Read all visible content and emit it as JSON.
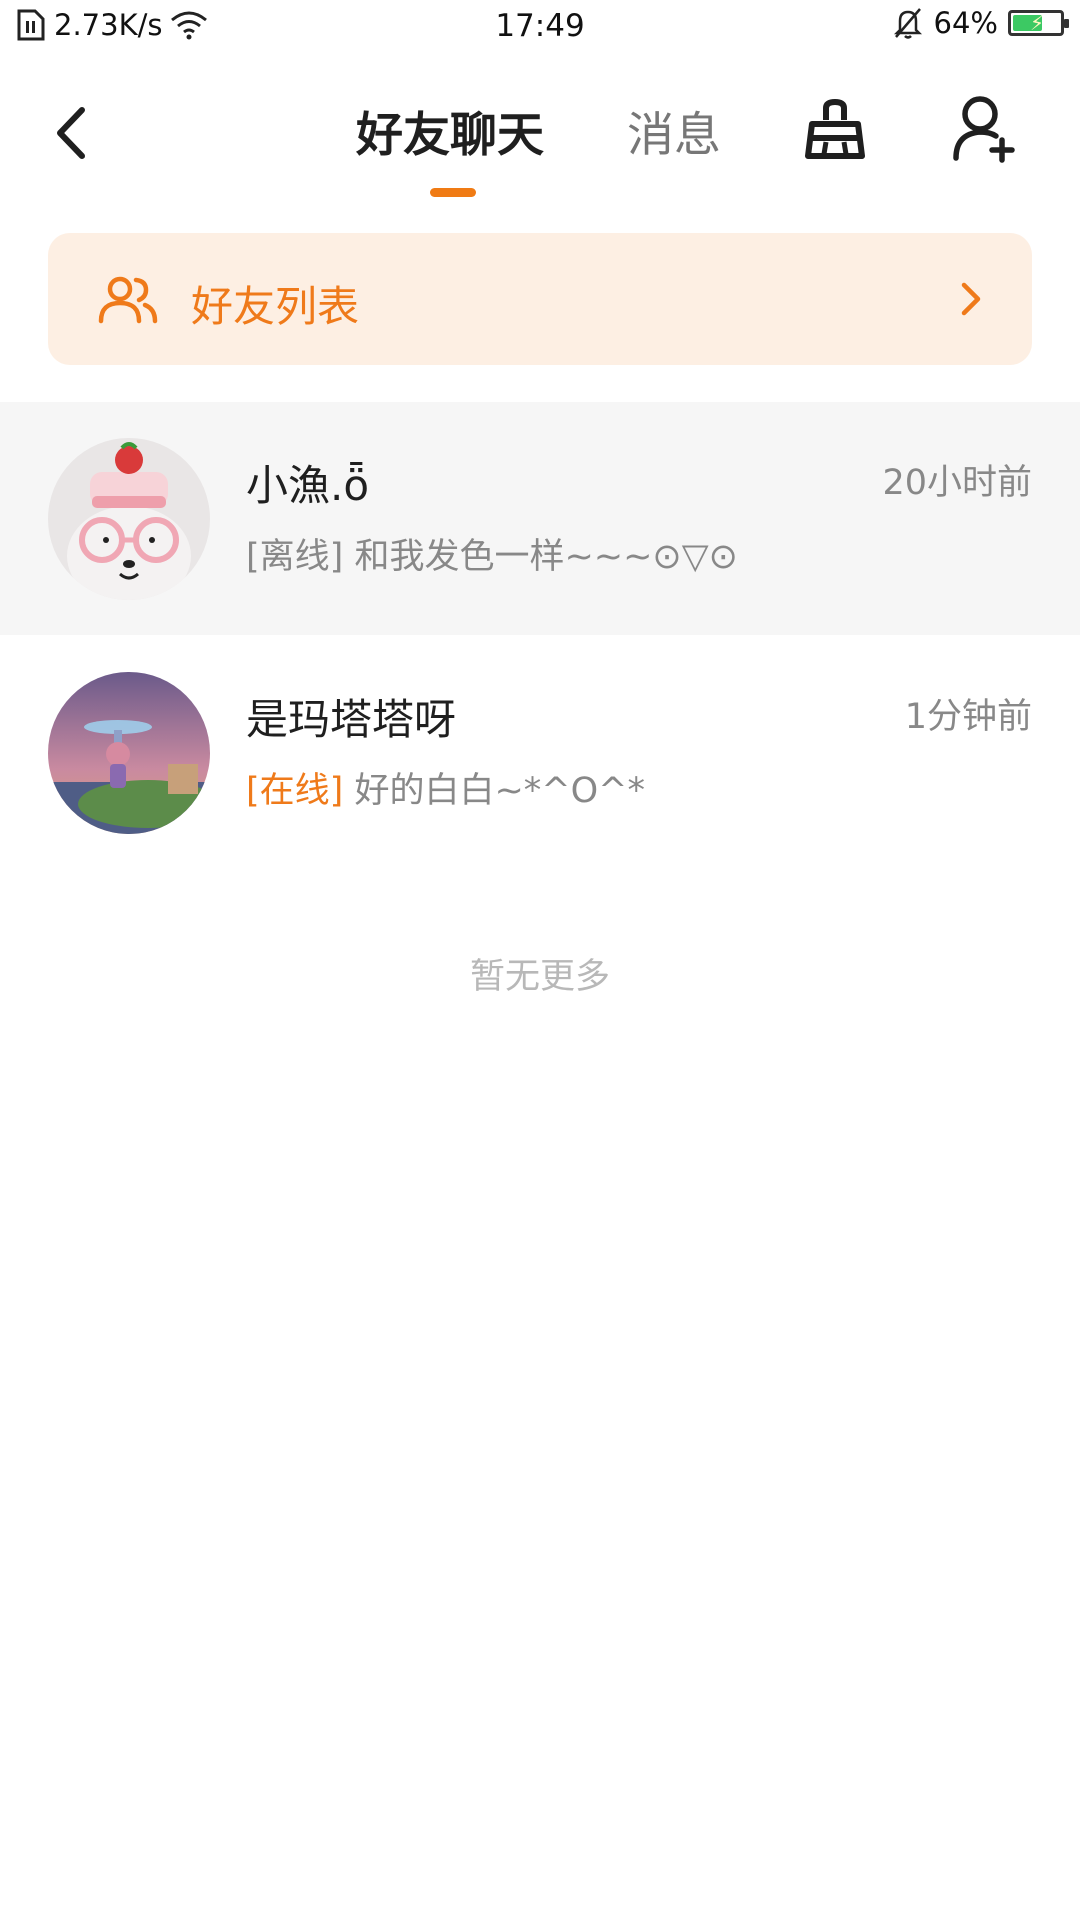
{
  "status_bar": {
    "network_speed": "2.73K/s",
    "time": "17:49",
    "battery_percent": "64%",
    "battery_level": 0.64,
    "icons": [
      "sim-icon",
      "wifi-icon",
      "muted-bell-icon",
      "battery-icon"
    ]
  },
  "nav": {
    "tabs": [
      {
        "label": "好友聊天",
        "active": true
      },
      {
        "label": "消息",
        "active": false
      }
    ],
    "accent_color": "#f07b14",
    "icons": [
      "back-arrow-icon",
      "clean-broom-icon",
      "add-friend-icon"
    ]
  },
  "friends_banner": {
    "label": "好友列表",
    "background": "#fdefe3",
    "text_color": "#ef7a1a"
  },
  "chats": [
    {
      "name": "小漁.ȫ",
      "time": "20小时前",
      "status": "[离线]",
      "message": "和我发色一样~~~⊙▽⊙",
      "online": false
    },
    {
      "name": "是玛塔塔呀",
      "time": "1分钟前",
      "status": "[在线]",
      "message": "好的白白~*^O^*",
      "online": true
    }
  ],
  "footer": {
    "no_more": "暂无更多"
  }
}
